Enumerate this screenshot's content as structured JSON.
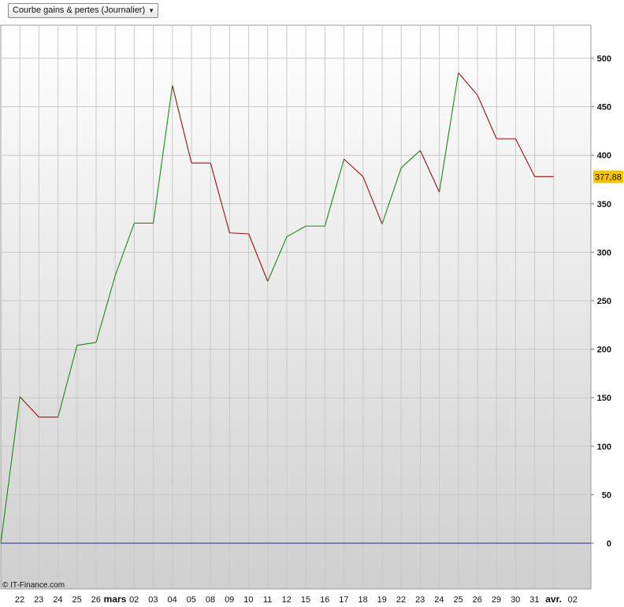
{
  "header": {
    "dropdown_label": "Courbe gains & pertes (Journalier)"
  },
  "footer": {
    "credit": "© IT-Finance.com"
  },
  "colors": {
    "up": "#1a8a1a",
    "down": "#9b1010",
    "zero_line": "#2020c0",
    "last_value_bg": "#f5c400",
    "grid": "#c8c8c8"
  },
  "chart_data": {
    "type": "line",
    "title": "Courbe gains & pertes (Journalier)",
    "xlabel": "",
    "ylabel": "",
    "ylim": [
      -45,
      530
    ],
    "grid": true,
    "x_axis_position": "bottom",
    "y_axis_position": "right",
    "y_ticks": [
      0,
      50,
      100,
      150,
      200,
      250,
      300,
      350,
      400,
      450,
      500
    ],
    "y_tick_labels": [
      "0",
      "50",
      "100",
      "150",
      "200",
      "250",
      "300",
      "350",
      "400",
      "450",
      "500"
    ],
    "categories": [
      "22",
      "23",
      "24",
      "25",
      "26",
      "mars",
      "02",
      "03",
      "04",
      "05",
      "08",
      "09",
      "10",
      "11",
      "12",
      "15",
      "16",
      "17",
      "18",
      "19",
      "22",
      "23",
      "24",
      "25",
      "26",
      "29",
      "30",
      "31",
      "avr.",
      "02"
    ],
    "bold_categories": [
      "mars",
      "avr."
    ],
    "series": [
      {
        "values": [
          0,
          151,
          130,
          130,
          204,
          207,
          276,
          330,
          330,
          472,
          392,
          392,
          320,
          319,
          270,
          316,
          327,
          327,
          396,
          378,
          329,
          387,
          405,
          362,
          485,
          462,
          417,
          417,
          378,
          378
        ]
      }
    ],
    "last_value_label": "377,88",
    "last_value": 377.88,
    "zero_line": 0
  }
}
